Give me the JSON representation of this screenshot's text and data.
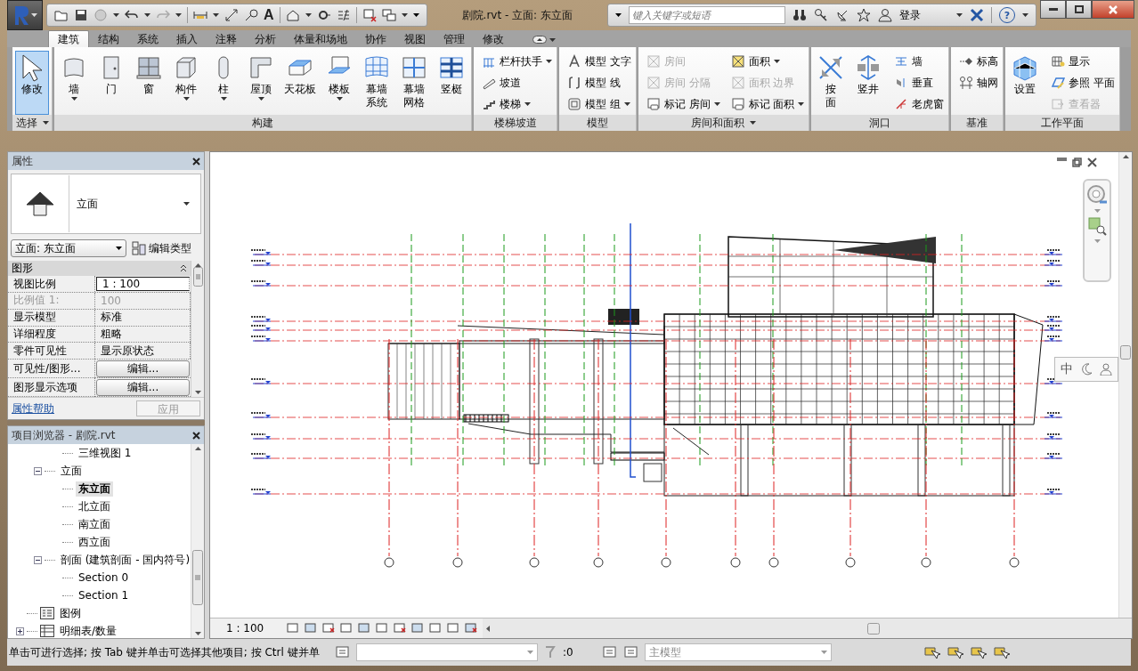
{
  "title_bar": {
    "title": "剧院.rvt - 立面: 东立面",
    "text_tool": "A",
    "search": {
      "placeholder": "键入关键字或短语"
    },
    "sign_in": "登录",
    "help": "?"
  },
  "tabs": [
    {
      "label": "建筑",
      "selected": true
    },
    {
      "label": "结构",
      "selected": false
    },
    {
      "label": "系统",
      "selected": false
    },
    {
      "label": "插入",
      "selected": false
    },
    {
      "label": "注释",
      "selected": false
    },
    {
      "label": "分析",
      "selected": false
    },
    {
      "label": "体量和场地",
      "selected": false
    },
    {
      "label": "协作",
      "selected": false
    },
    {
      "label": "视图",
      "selected": false
    },
    {
      "label": "管理",
      "selected": false
    },
    {
      "label": "修改",
      "selected": false
    }
  ],
  "ribbon_panels": [
    {
      "title": "选择",
      "menu": true,
      "tools": [
        {
          "label": "修改",
          "kind": "large",
          "selected": true
        }
      ]
    },
    {
      "title": "构建",
      "tools": [
        {
          "label": "墙",
          "kind": "large",
          "dropdown": true
        },
        {
          "label": "门",
          "kind": "large"
        },
        {
          "label": "窗",
          "kind": "large"
        },
        {
          "label": "构件",
          "kind": "large",
          "dropdown": true
        },
        {
          "label": "柱",
          "kind": "large",
          "dropdown": true
        },
        {
          "label": "屋顶",
          "kind": "large",
          "dropdown": true
        },
        {
          "label": "天花板",
          "kind": "large"
        },
        {
          "label": "楼板",
          "kind": "large",
          "dropdown": true
        },
        {
          "label": "幕墙系统",
          "kind": "large-wrap"
        },
        {
          "label": "幕墙网格",
          "kind": "large-wrap"
        },
        {
          "label": "竖梃",
          "kind": "large"
        }
      ]
    },
    {
      "title": "楼梯坡道",
      "tools": [
        {
          "label": "栏杆扶手",
          "kind": "small",
          "dropdown": true
        },
        {
          "label": "坡道",
          "kind": "small"
        },
        {
          "label": "楼梯",
          "kind": "small",
          "dropdown": true
        }
      ]
    },
    {
      "title": "模型",
      "tools": [
        {
          "label": "模型 文字",
          "kind": "small"
        },
        {
          "label": "模型 线",
          "kind": "small"
        },
        {
          "label": "模型 组",
          "kind": "small",
          "dropdown": true
        }
      ]
    },
    {
      "title": "房间和面积",
      "menu": true,
      "tools": [
        {
          "label": "房间",
          "kind": "small",
          "disabled": true
        },
        {
          "label": "房间 分隔",
          "kind": "small",
          "disabled": true
        },
        {
          "label": "标记 房间",
          "kind": "small",
          "dropdown": true
        },
        {
          "label": "面积",
          "kind": "small",
          "dropdown": true
        },
        {
          "label": "面积 边界",
          "kind": "small",
          "disabled": true
        },
        {
          "label": "标记 面积",
          "kind": "small",
          "dropdown": true
        }
      ]
    },
    {
      "title": "洞口",
      "tools": [
        {
          "label": "按面",
          "kind": "large-stack"
        },
        {
          "label": "竖井",
          "kind": "large"
        },
        {
          "label": "墙",
          "kind": "small"
        },
        {
          "label": "垂直",
          "kind": "small"
        },
        {
          "label": "老虎窗",
          "kind": "small"
        }
      ]
    },
    {
      "title": "基准",
      "tools": [
        {
          "label": "标高",
          "kind": "small"
        },
        {
          "label": "轴网",
          "kind": "small"
        }
      ]
    },
    {
      "title": "工作平面",
      "tools": [
        {
          "label": "设置",
          "kind": "large"
        },
        {
          "label": "显示",
          "kind": "small"
        },
        {
          "label": "参照 平面",
          "kind": "small"
        },
        {
          "label": "查看器",
          "kind": "small",
          "disabled": true
        }
      ]
    }
  ],
  "properties": {
    "title": "属性",
    "type_name": "立面",
    "instance": "立面: 东立面",
    "edit_type": "编辑类型",
    "group": "图形",
    "rows": [
      {
        "label": "视图比例",
        "value": "1 : 100",
        "kind": "field",
        "disabled": false
      },
      {
        "label": "比例值 1:",
        "value": "100",
        "kind": "text",
        "disabled": true
      },
      {
        "label": "显示模型",
        "value": "标准",
        "kind": "text",
        "disabled": false
      },
      {
        "label": "详细程度",
        "value": "粗略",
        "kind": "text",
        "disabled": false
      },
      {
        "label": "零件可见性",
        "value": "显示原状态",
        "kind": "text",
        "disabled": false
      },
      {
        "label": "可见性/图形...",
        "value": "编辑...",
        "kind": "button",
        "disabled": false
      },
      {
        "label": "图形显示选项",
        "value": "编辑...",
        "kind": "button",
        "disabled": false
      }
    ],
    "help_link": "属性帮助",
    "apply": {
      "label": "应用",
      "disabled": true
    }
  },
  "project_browser": {
    "title": "项目浏览器 - 剧院.rvt",
    "tree": [
      {
        "children": [
          {
            "children": [
              {
                "label": "三维视图 1",
                "selected": false
              }
            ]
          },
          {
            "label": "立面",
            "expanded": true,
            "children": [
              {
                "label": "东立面",
                "selected": true
              },
              {
                "label": "北立面",
                "selected": false
              },
              {
                "label": "南立面",
                "selected": false
              },
              {
                "label": "西立面",
                "selected": false
              }
            ]
          },
          {
            "label": "剖面 (建筑剖面 - 国内符号)",
            "expanded": true,
            "children": [
              {
                "label": "Section 0",
                "selected": false
              },
              {
                "label": "Section 1",
                "selected": false
              }
            ]
          }
        ]
      },
      {
        "label": "图例",
        "kind": "legend"
      },
      {
        "label": "明细表/数量",
        "kind": "schedule",
        "expanded": false
      }
    ]
  },
  "view": {
    "scale": "1 : 100",
    "ime_mode": "中"
  },
  "status_bar": {
    "message": "单击可进行选择; 按 Tab 键并单击可选择其他项目; 按 Ctrl 键并单",
    "count": ":0",
    "model": "主模型"
  }
}
